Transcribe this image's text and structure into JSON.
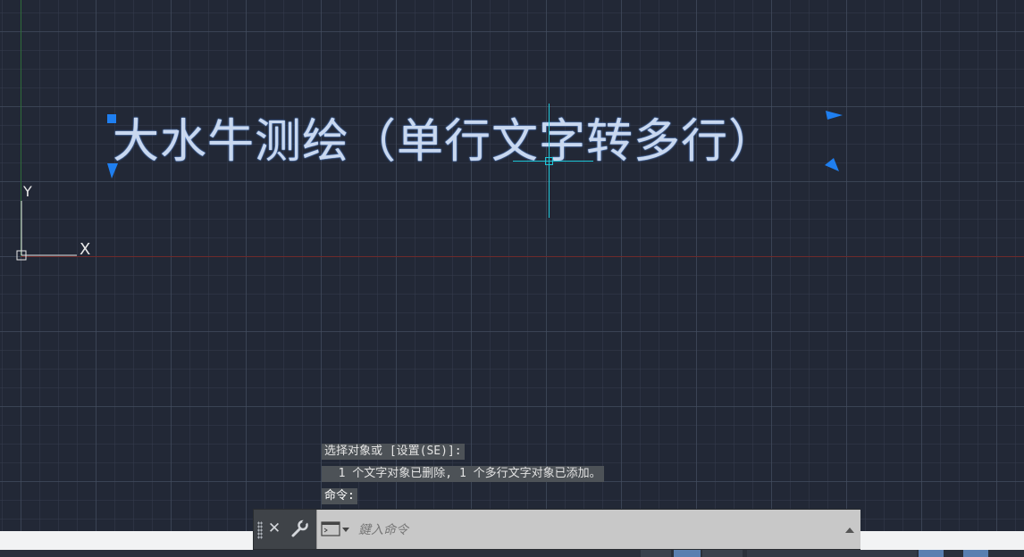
{
  "drawing": {
    "text_entity": "大水牛测绘（单行文字转多行）",
    "ucs": {
      "y_label": "Y",
      "x_label": "X"
    }
  },
  "command_history": [
    "选择对象或 [设置(SE)]:",
    "  1 个文字对象已删除, 1 个多行文字对象已添加。",
    "命令:"
  ],
  "command_line": {
    "placeholder": "鍵入命令",
    "close_icon": "close-icon",
    "customize_icon": "wrench-icon",
    "prompt_icon": "command-prompt-icon"
  },
  "colors": {
    "canvas_bg": "#222836",
    "grip_blue": "#1f7ff0",
    "crosshair": "#1fc7d8",
    "text": "#c9d8ef"
  }
}
